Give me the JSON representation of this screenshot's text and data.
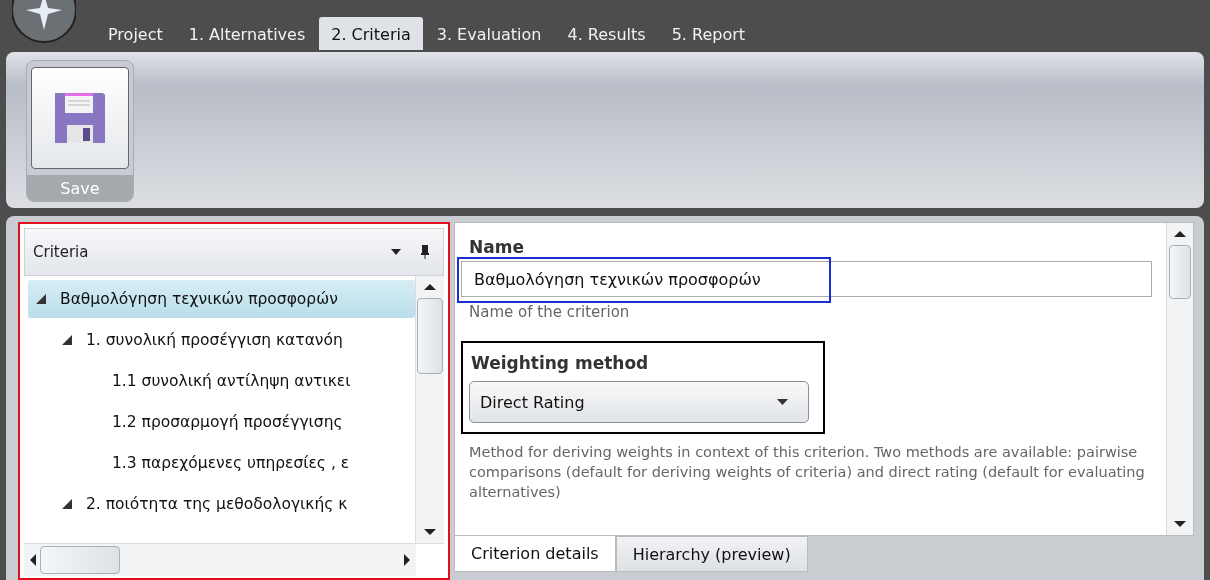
{
  "tabs": [
    {
      "label": "Project",
      "selected": false
    },
    {
      "label": "1. Alternatives",
      "selected": false
    },
    {
      "label": "2. Criteria",
      "selected": true
    },
    {
      "label": "3. Evaluation",
      "selected": false
    },
    {
      "label": "4. Results",
      "selected": false
    },
    {
      "label": "5. Report",
      "selected": false
    }
  ],
  "ribbon": {
    "buttons": [
      {
        "label": "Save"
      }
    ]
  },
  "criteria_panel": {
    "title": "Criteria",
    "tree": [
      {
        "label": "Βαθμολόγηση τεχνικών προσφορών",
        "selected": true,
        "expanded": true,
        "children": [
          {
            "label": "1. συνολική προσέγγιση κατανόη",
            "selected": false,
            "expanded": true,
            "children": [
              {
                "label": "1.1 συνολική αντίληψη αντικει",
                "selected": false
              },
              {
                "label": "1.2 προσαρμογή προσέγγισης",
                "selected": false
              },
              {
                "label": "1.3 παρεχόμενες υπηρεσίες , ε",
                "selected": false
              }
            ]
          },
          {
            "label": "2. ποιότητα της μεθοδολογικής κ",
            "selected": false,
            "expanded": true
          }
        ]
      }
    ]
  },
  "details": {
    "name_label": "Name",
    "name_value": "Βαθμολόγηση τεχνικών προσφορών",
    "name_hint": "Name of the criterion",
    "method_label": "Weighting method",
    "method_value": "Direct Rating",
    "method_hint": "Method for deriving weights in context of this criterion. Two methods are available: pairwise comparisons (default for deriving weights of criteria) and direct rating (default for evaluating alternatives)",
    "tabs": [
      {
        "label": "Criterion details",
        "selected": true
      },
      {
        "label": "Hierarchy (preview)",
        "selected": false
      }
    ]
  }
}
